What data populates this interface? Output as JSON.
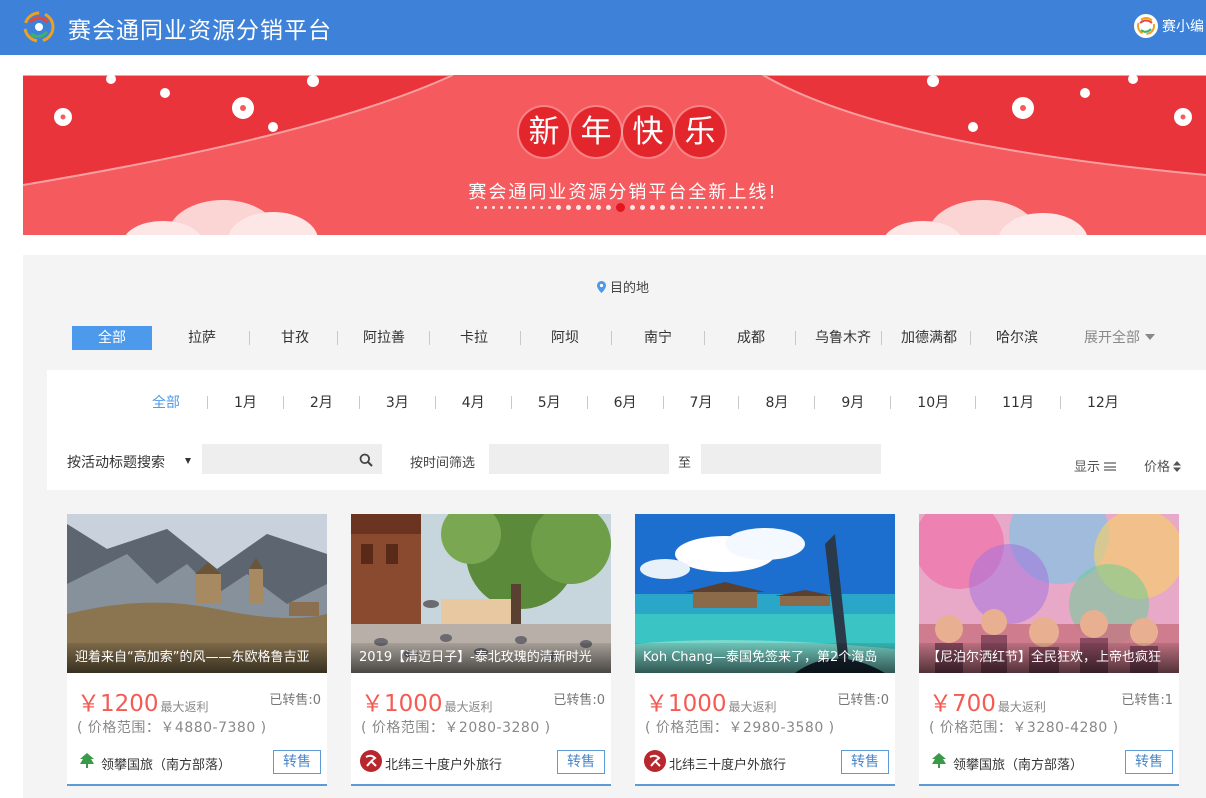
{
  "header": {
    "title": "赛会通同业资源分销平台",
    "user_name": "赛小编"
  },
  "banner": {
    "title_chars": [
      "新",
      "年",
      "快",
      "乐"
    ],
    "subtitle": "赛会通同业资源分销平台全新上线!"
  },
  "filters": {
    "destination_label": "目的地",
    "cities": [
      "全部",
      "拉萨",
      "甘孜",
      "阿拉善",
      "卡拉",
      "阿坝",
      "南宁",
      "成都",
      "乌鲁木齐",
      "加德满都",
      "哈尔滨"
    ],
    "expand_label": "展开全部",
    "months": [
      "全部",
      "1月",
      "2月",
      "3月",
      "4月",
      "5月",
      "6月",
      "7月",
      "8月",
      "9月",
      "10月",
      "11月",
      "12月"
    ],
    "search_mode_label": "按活动标题搜索",
    "time_filter_label": "按时间筛选",
    "to_label": "至",
    "display_label": "显示",
    "price_sort_label": "价格"
  },
  "cards": [
    {
      "caption": "迎着来自“高加索”的风——东欧格鲁吉亚",
      "price": "￥1200",
      "price_label": "最大返利",
      "sold": "已转售:0",
      "range": "( 价格范围：￥4880-7380 )",
      "agency": "领攀国旅（南方部落）",
      "button": "转售"
    },
    {
      "caption": "2019【清迈日子】-泰北玫瑰的清新时光",
      "price": "￥1000",
      "price_label": "最大返利",
      "sold": "已转售:0",
      "range": "( 价格范围：￥2080-3280 )",
      "agency": "北纬三十度户外旅行",
      "button": "转售"
    },
    {
      "caption": "Koh Chang—泰国免签来了，第2个海岛",
      "price": "￥1000",
      "price_label": "最大返利",
      "sold": "已转售:0",
      "range": "( 价格范围：￥2980-3580 )",
      "agency": "北纬三十度户外旅行",
      "button": "转售"
    },
    {
      "caption": "【尼泊尔洒红节】全民狂欢，上帝也疯狂",
      "price": "￥700",
      "price_label": "最大返利",
      "sold": "已转售:1",
      "range": "( 价格范围：￥3280-4280 )",
      "agency": "领攀国旅（南方部落）",
      "button": "转售"
    }
  ],
  "colors": {
    "header_bg": "#3d82d8",
    "banner_bg": "#f45a5e",
    "accent_blue": "#4d9aed",
    "price_red": "#f35b53"
  }
}
